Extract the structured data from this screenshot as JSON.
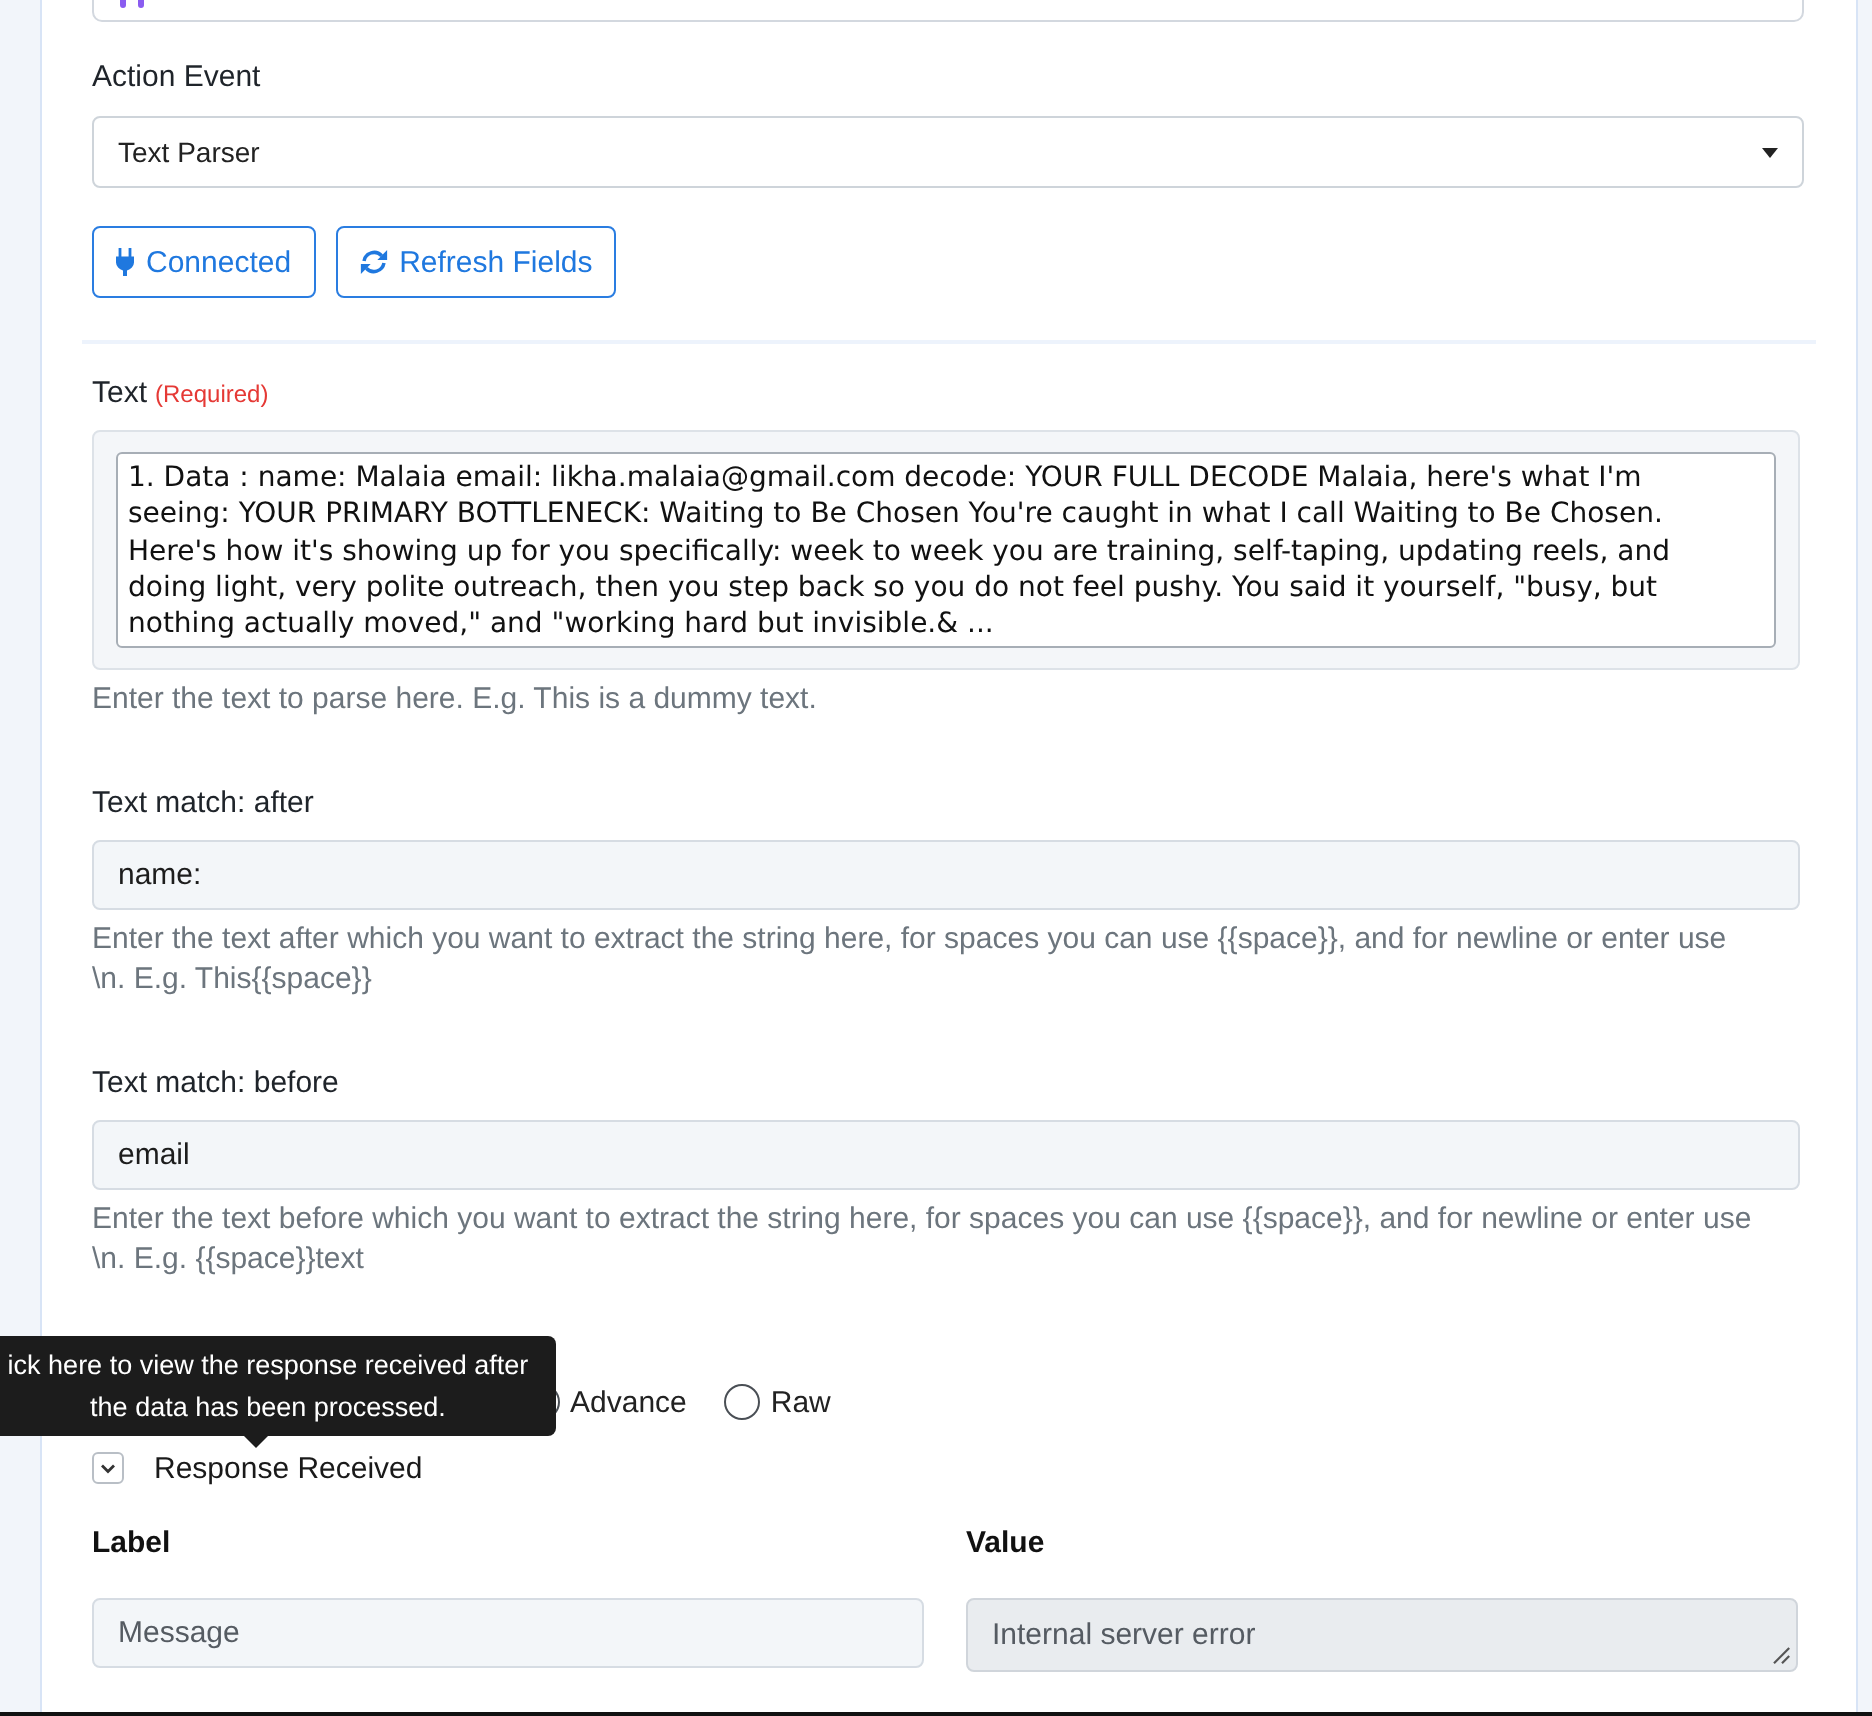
{
  "action_event": {
    "label": "Action Event",
    "value": "Text Parser"
  },
  "buttons": [
    {
      "kind": "connect",
      "label": "Connected"
    },
    {
      "kind": "refresh",
      "label": "Refresh Fields"
    }
  ],
  "text_input": {
    "label": "Text",
    "required_note": "(Required)",
    "value": "1. Data : name: Malaia email: likha.malaia@gmail.com decode: YOUR FULL DECODE Malaia, here's what I'm seeing: YOUR PRIMARY BOTTLENECK: Waiting to Be Chosen You're caught in what I call Waiting to Be Chosen. Here's how it's showing up for you specifically: week to week you are training, self-taping, updating reels, and doing light, very polite outreach, then you step back so you do not feel pushy. You said it yourself, \"busy, but nothing actually moved,\" and \"working hard but invisible.& ...",
    "help": "Enter the text to parse here. E.g. This is a dummy text."
  },
  "text_match_after": {
    "label": "Text match: after",
    "value": "name:",
    "help": "Enter the text after which you want to extract the string here, for spaces you can use {{space}}, and for newline or enter use \\n. E.g. This{{space}}"
  },
  "text_match_before": {
    "label": "Text match: before",
    "value": "email",
    "help": "Enter the text before which you want to extract the string here, for spaces you can use {{space}}, and for newline or enter use \\n. E.g. {{space}}text"
  },
  "response_format": {
    "options": [
      {
        "label": "Advance",
        "selected": false
      },
      {
        "label": "Raw",
        "selected": false
      }
    ]
  },
  "tooltip": {
    "text": "ick here to view the response received after the data has been processed."
  },
  "response_received": {
    "label": "Response Received",
    "expanded": true,
    "columns": [
      "Label",
      "Value"
    ],
    "rows": [
      {
        "cells": [
          {
            "kind": "input",
            "text": "Message",
            "disabled": false
          },
          {
            "kind": "textarea",
            "text": "Internal server error",
            "disabled": true
          }
        ]
      }
    ]
  }
}
